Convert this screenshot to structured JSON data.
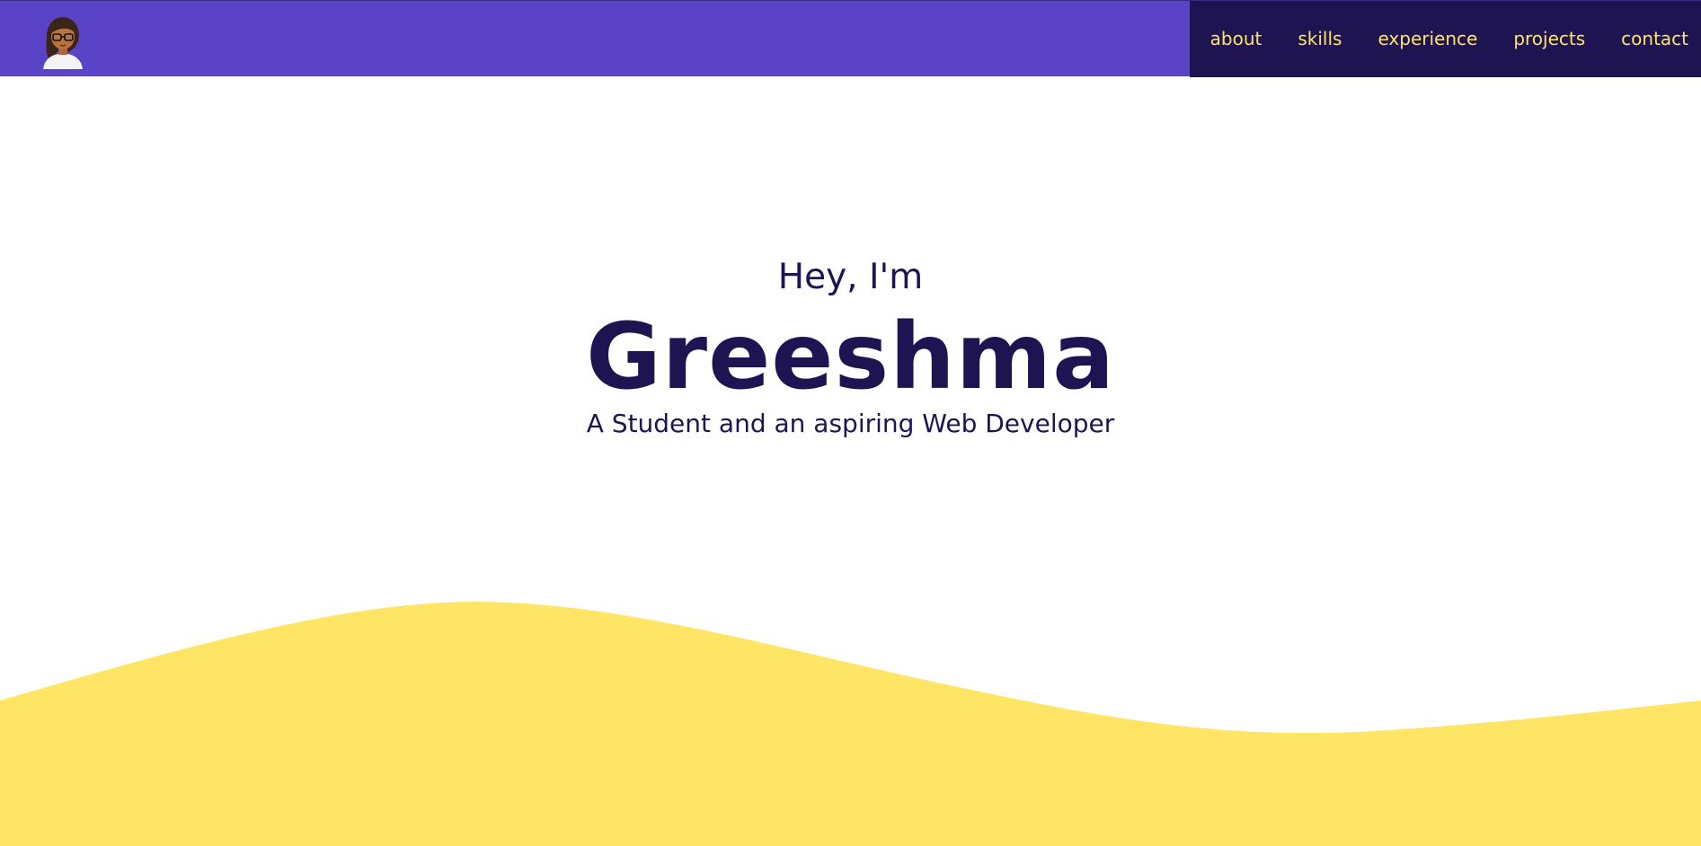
{
  "header": {
    "logo_icon": "avatar-girl-with-glasses-icon",
    "nav": [
      {
        "label": "about"
      },
      {
        "label": "skills"
      },
      {
        "label": "experience"
      },
      {
        "label": "projects"
      },
      {
        "label": "contact"
      }
    ]
  },
  "hero": {
    "greeting": "Hey, I'm",
    "name": "Greeshma",
    "tagline": "A Student and an aspiring Web Developer"
  },
  "colors": {
    "navbar": "#5b43c7",
    "nav_panel": "#1f1452",
    "nav_text": "#fde36a",
    "text": "#1f1452",
    "wave": "#fee566",
    "background": "#ffffff"
  }
}
